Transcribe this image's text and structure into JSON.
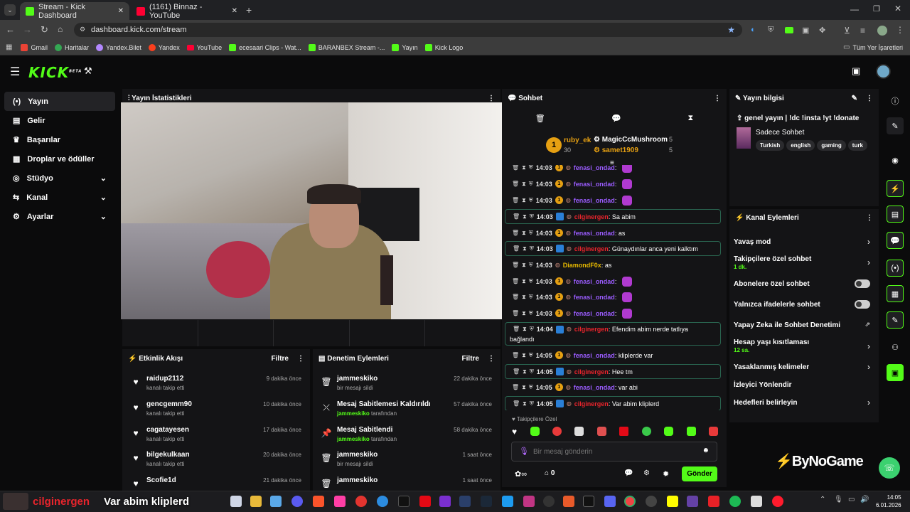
{
  "browser": {
    "tabs": [
      {
        "title": "Stream - Kick Dashboard"
      },
      {
        "title": "(1161) Binnaz - YouTube"
      }
    ],
    "url": "dashboard.kick.com/stream",
    "bookmarks": [
      "Gmail",
      "Haritalar",
      "Yandex.Bilet",
      "Yandex",
      "YouTube",
      "ecesaari Clips - Wat...",
      "BARANBEX Stream -...",
      "Yayın",
      "Kick Logo"
    ],
    "all_bookmarks": "Tüm Yer İşaretleri"
  },
  "kick": {
    "logo": "KICK",
    "logo_beta": "BETA",
    "nav": [
      {
        "label": "Yayın"
      },
      {
        "label": "Gelir"
      },
      {
        "label": "Başarılar"
      },
      {
        "label": "Droplar ve ödüller"
      },
      {
        "label": "Stüdyo"
      },
      {
        "label": "Kanal"
      },
      {
        "label": "Ayarlar"
      }
    ]
  },
  "stats": {
    "title": "Yayın İstatistikleri"
  },
  "events": {
    "title": "Etkinlik Akışı",
    "filter": "Filtre",
    "items": [
      {
        "name": "raidup2112",
        "sub": "kanalı takip etti",
        "time": "9 dakika önce"
      },
      {
        "name": "gencgemm90",
        "sub": "kanalı takip etti",
        "time": "10 dakika önce"
      },
      {
        "name": "cagatayesen",
        "sub": "kanalı takip etti",
        "time": "17 dakika önce"
      },
      {
        "name": "bilgekulkaan",
        "sub": "kanalı takip etti",
        "time": "20 dakika önce"
      },
      {
        "name": "Scofie1d",
        "sub": "",
        "time": "21 dakika önce"
      }
    ]
  },
  "moderation": {
    "title": "Denetim Eylemleri",
    "filter": "Filtre",
    "items": [
      {
        "name": "jammeskiko",
        "by": "",
        "sub": "bir mesajı sildi",
        "time": "22 dakika önce"
      },
      {
        "name": "Mesaj Sabitlemesi Kaldırıldı",
        "by": "jammeskiko",
        "sub": "tarafından",
        "time": "57 dakika önce"
      },
      {
        "name": "Mesaj Sabitlendi",
        "by": "jammeskiko",
        "sub": "tarafından",
        "time": "58 dakika önce"
      },
      {
        "name": "jammeskiko",
        "by": "",
        "sub": "bir mesajı sildi",
        "time": "1 saat önce"
      },
      {
        "name": "jammeskiko",
        "by": "",
        "sub": "",
        "time": "1 saat önce"
      }
    ]
  },
  "chat": {
    "title": "Sohbet",
    "top": [
      {
        "rank": "1",
        "name": "ruby_ek",
        "count": "30"
      },
      {
        "rank": "",
        "name": "MagicCcMushroom",
        "count": "5"
      },
      {
        "rank": "",
        "name": "samet1909",
        "count": "5"
      }
    ],
    "messages": [
      {
        "time": "14:03",
        "user": "fenasi_ondad",
        "text": ":",
        "cls": "u1"
      },
      {
        "time": "14:03",
        "user": "fenasi_ondad",
        "text": ":",
        "cls": "u1"
      },
      {
        "time": "14:03",
        "user": "fenasi_ondad",
        "text": ":",
        "cls": "u1"
      },
      {
        "time": "14:03",
        "user": "cilginergen",
        "text": ": Sa abim",
        "cls": "u2"
      },
      {
        "time": "14:03",
        "user": "fenasi_ondad",
        "text": ": as",
        "cls": "u1"
      },
      {
        "time": "14:03",
        "user": "cilginergen",
        "text": ": Günaydınlar anca yeni kalktım",
        "cls": "u2"
      },
      {
        "time": "14:03",
        "user": "DiamondF0x",
        "text": ": as",
        "cls": "u3"
      },
      {
        "time": "14:03",
        "user": "fenasi_ondad",
        "text": ":",
        "cls": "u1"
      },
      {
        "time": "14:03",
        "user": "fenasi_ondad",
        "text": ":",
        "cls": "u1"
      },
      {
        "time": "14:03",
        "user": "fenasi_ondad",
        "text": ":",
        "cls": "u1"
      },
      {
        "time": "14:04",
        "user": "cilginergen",
        "text": ": Efendim abim nerde tatlıya",
        "cls": "u2",
        "cont": "bağlandı"
      },
      {
        "time": "14:05",
        "user": "fenasi_ondad",
        "text": ": kliplerde var",
        "cls": "u1"
      },
      {
        "time": "14:05",
        "user": "cilginergen",
        "text": ": Hee tm",
        "cls": "u2"
      },
      {
        "time": "14:05",
        "user": "fenasi_ondad",
        "text": ": var abi",
        "cls": "u1"
      },
      {
        "time": "14:05",
        "user": "cilginergen",
        "text": ": Var abim kliplerd",
        "cls": "u2"
      }
    ],
    "followers_only": "Takipçilere Özel",
    "placeholder": "Bir mesaj gönderin",
    "count": "0",
    "send": "Gönder"
  },
  "info": {
    "title": "Yayın bilgisi",
    "stream_title": "genel yayın | !dc !insta !yt !donate",
    "category": "Sadece Sohbet",
    "tags": [
      "Turkish",
      "english",
      "gaming",
      "turk"
    ]
  },
  "actions": {
    "title": "Kanal Eylemleri",
    "items": [
      {
        "label": "Yavaş mod",
        "sub": ""
      },
      {
        "label": "Takipçilere özel sohbet",
        "sub": "1 dk."
      },
      {
        "label": "Abonelere özel sohbet",
        "sub": ""
      },
      {
        "label": "Yalnızca ifadelerle sohbet",
        "sub": ""
      },
      {
        "label": "Yapay Zeka ile Sohbet Denetimi",
        "sub": ""
      },
      {
        "label": "Hesap yaşı kısıtlaması",
        "sub": "12 sa."
      },
      {
        "label": "Yasaklanmış kelimeler",
        "sub": ""
      },
      {
        "label": "İzleyici Yönlendir",
        "sub": ""
      },
      {
        "label": "Hedefleri belirleyin",
        "sub": ""
      }
    ]
  },
  "overlay": {
    "user": "cilginergen",
    "text": "Var abim kliplerd",
    "brand": "ByNoGame"
  },
  "taskbar": {
    "time": "14:05",
    "date": "6.01.2026"
  }
}
